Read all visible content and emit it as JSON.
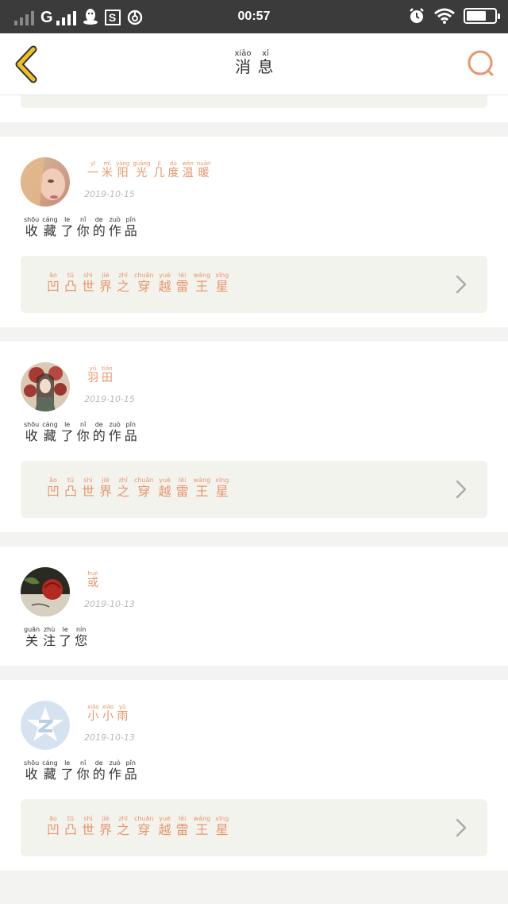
{
  "status_bar": {
    "network": "G",
    "time": "00:57",
    "battery_level": 0.72
  },
  "header": {
    "title": [
      {
        "char": "消",
        "pinyin": "xiāo"
      },
      {
        "char": "息",
        "pinyin": "xī"
      }
    ]
  },
  "colors": {
    "accent": "#e8956a",
    "card_bg": "#f3f3ee",
    "back_arrow": "#f0c020"
  },
  "messages": [
    {
      "user": [
        {
          "char": "一",
          "pinyin": "yī"
        },
        {
          "char": "米",
          "pinyin": "mǐ"
        },
        {
          "char": "阳",
          "pinyin": "yáng"
        },
        {
          "char": "光",
          "pinyin": "guāng"
        },
        {
          "char": "几",
          "pinyin": "jǐ"
        },
        {
          "char": "度",
          "pinyin": "dù"
        },
        {
          "char": "温",
          "pinyin": "wēn"
        },
        {
          "char": "暖",
          "pinyin": "nuǎn"
        }
      ],
      "date": "2019-10-15",
      "action": [
        {
          "char": "收",
          "pinyin": "shōu"
        },
        {
          "char": "藏",
          "pinyin": "cáng"
        },
        {
          "char": "了",
          "pinyin": "le"
        },
        {
          "char": "你",
          "pinyin": "nǐ"
        },
        {
          "char": "的",
          "pinyin": "de"
        },
        {
          "char": "作",
          "pinyin": "zuò"
        },
        {
          "char": "品",
          "pinyin": "pǐn"
        }
      ],
      "work": [
        {
          "char": "凹",
          "pinyin": "āo"
        },
        {
          "char": "凸",
          "pinyin": "tū"
        },
        {
          "char": "世",
          "pinyin": "shì"
        },
        {
          "char": "界",
          "pinyin": "jiè"
        },
        {
          "char": "之",
          "pinyin": "zhī"
        },
        {
          "char": "穿",
          "pinyin": "chuān"
        },
        {
          "char": "越",
          "pinyin": "yuè"
        },
        {
          "char": "雷",
          "pinyin": "léi"
        },
        {
          "char": "王",
          "pinyin": "wáng"
        },
        {
          "char": "星",
          "pinyin": "xīng"
        }
      ]
    },
    {
      "user": [
        {
          "char": "羽",
          "pinyin": "yǔ"
        },
        {
          "char": "田",
          "pinyin": "tián"
        }
      ],
      "date": "2019-10-15",
      "action": [
        {
          "char": "收",
          "pinyin": "shōu"
        },
        {
          "char": "藏",
          "pinyin": "cáng"
        },
        {
          "char": "了",
          "pinyin": "le"
        },
        {
          "char": "你",
          "pinyin": "nǐ"
        },
        {
          "char": "的",
          "pinyin": "de"
        },
        {
          "char": "作",
          "pinyin": "zuò"
        },
        {
          "char": "品",
          "pinyin": "pǐn"
        }
      ],
      "work": [
        {
          "char": "凹",
          "pinyin": "āo"
        },
        {
          "char": "凸",
          "pinyin": "tū"
        },
        {
          "char": "世",
          "pinyin": "shì"
        },
        {
          "char": "界",
          "pinyin": "jiè"
        },
        {
          "char": "之",
          "pinyin": "zhī"
        },
        {
          "char": "穿",
          "pinyin": "chuān"
        },
        {
          "char": "越",
          "pinyin": "yuè"
        },
        {
          "char": "雷",
          "pinyin": "léi"
        },
        {
          "char": "王",
          "pinyin": "wáng"
        },
        {
          "char": "星",
          "pinyin": "xīng"
        }
      ]
    },
    {
      "user": [
        {
          "char": "或",
          "pinyin": "huò"
        }
      ],
      "date": "2019-10-13",
      "action": [
        {
          "char": "关",
          "pinyin": "guān"
        },
        {
          "char": "注",
          "pinyin": "zhù"
        },
        {
          "char": "了",
          "pinyin": "le"
        },
        {
          "char": "您",
          "pinyin": "nín"
        }
      ],
      "work": null
    },
    {
      "user": [
        {
          "char": "小",
          "pinyin": "xiǎo"
        },
        {
          "char": "小",
          "pinyin": "xiǎo"
        },
        {
          "char": "雨",
          "pinyin": "yǔ"
        }
      ],
      "date": "2019-10-13",
      "action": [
        {
          "char": "收",
          "pinyin": "shōu"
        },
        {
          "char": "藏",
          "pinyin": "cáng"
        },
        {
          "char": "了",
          "pinyin": "le"
        },
        {
          "char": "你",
          "pinyin": "nǐ"
        },
        {
          "char": "的",
          "pinyin": "de"
        },
        {
          "char": "作",
          "pinyin": "zuò"
        },
        {
          "char": "品",
          "pinyin": "pǐn"
        }
      ],
      "work": [
        {
          "char": "凹",
          "pinyin": "āo"
        },
        {
          "char": "凸",
          "pinyin": "tū"
        },
        {
          "char": "世",
          "pinyin": "shì"
        },
        {
          "char": "界",
          "pinyin": "jiè"
        },
        {
          "char": "之",
          "pinyin": "zhī"
        },
        {
          "char": "穿",
          "pinyin": "chuān"
        },
        {
          "char": "越",
          "pinyin": "yuè"
        },
        {
          "char": "雷",
          "pinyin": "léi"
        },
        {
          "char": "王",
          "pinyin": "wáng"
        },
        {
          "char": "星",
          "pinyin": "xīng"
        }
      ]
    }
  ]
}
